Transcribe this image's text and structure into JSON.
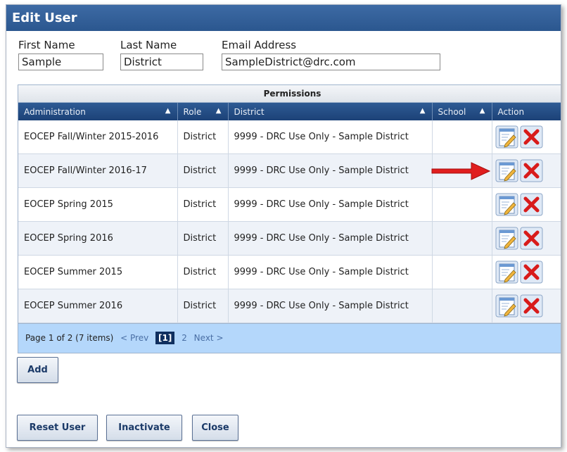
{
  "window": {
    "title": "Edit User"
  },
  "form": {
    "first_name": {
      "label": "First Name",
      "value": "Sample"
    },
    "last_name": {
      "label": "Last Name",
      "value": "District"
    },
    "email": {
      "label": "Email Address",
      "value": "SampleDistrict@drc.com"
    }
  },
  "permissions": {
    "caption": "Permissions",
    "columns": [
      "Administration",
      "Role",
      "District",
      "School",
      "Action"
    ],
    "rows": [
      {
        "administration": "EOCEP Fall/Winter 2015-2016",
        "role": "District",
        "district": "9999 - DRC Use Only - Sample District",
        "school": ""
      },
      {
        "administration": "EOCEP Fall/Winter 2016-17",
        "role": "District",
        "district": "9999 - DRC Use Only - Sample District",
        "school": ""
      },
      {
        "administration": "EOCEP Spring 2015",
        "role": "District",
        "district": "9999 - DRC Use Only - Sample District",
        "school": ""
      },
      {
        "administration": "EOCEP Spring 2016",
        "role": "District",
        "district": "9999 - DRC Use Only - Sample District",
        "school": ""
      },
      {
        "administration": "EOCEP Summer 2015",
        "role": "District",
        "district": "9999 - DRC Use Only - Sample District",
        "school": ""
      },
      {
        "administration": "EOCEP Summer 2016",
        "role": "District",
        "district": "9999 - DRC Use Only - Sample District",
        "school": ""
      }
    ],
    "action_icons": [
      "edit-icon",
      "delete-icon"
    ],
    "pager": {
      "summary": "Page 1 of 2 (7 items)",
      "prev": "< Prev",
      "current": "[1]",
      "page2": "2",
      "next": "Next >"
    }
  },
  "buttons": {
    "add": "Add",
    "reset_user": "Reset User",
    "inactivate": "Inactivate",
    "close": "Close"
  },
  "colors": {
    "header_blue": "#2b578f",
    "pager_blue": "#b4d7fb",
    "delete_red": "#d81b1b",
    "annotation_arrow": "#e01e1e"
  },
  "annotation": {
    "type": "red-arrow",
    "points_to_row": 2
  }
}
